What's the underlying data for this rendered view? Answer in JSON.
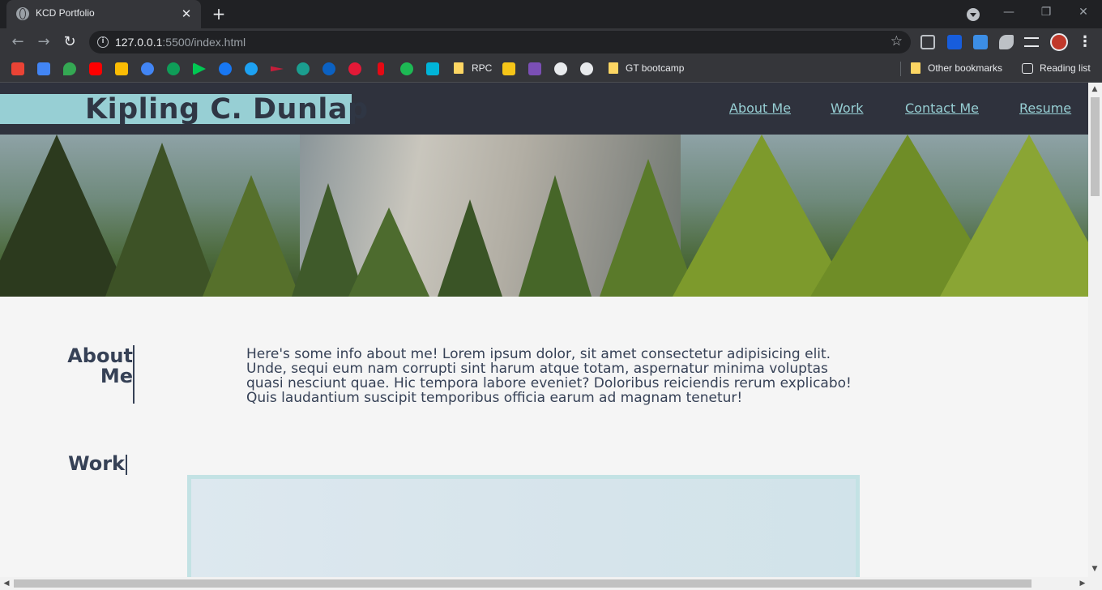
{
  "browser": {
    "tab_title": "KCD Portfolio",
    "url_host": "127.0.0.1",
    "url_path": ":5500/index.html",
    "bookmarks": [
      {
        "label": "RPC"
      },
      {
        "label": "GT bootcamp"
      },
      {
        "label": "Other bookmarks"
      },
      {
        "label": "Reading list"
      }
    ]
  },
  "site": {
    "name": "Kipling C. Dunlap",
    "nav": [
      {
        "label": "About Me"
      },
      {
        "label": "Work"
      },
      {
        "label": "Contact Me"
      },
      {
        "label": "Resume"
      }
    ],
    "about": {
      "title_line1": "About",
      "title_line2": "Me",
      "text": "Here's some info about me! Lorem ipsum dolor, sit amet consectetur adipisicing elit. Unde, sequi eum nam corrupti sint harum atque totam, aspernatur minima voluptas quasi nesciunt quae. Hic tempora labore eveniet? Doloribus reiciendis rerum explicabo! Quis laudantium suscipit temporibus officia earum ad magnam tenetur!"
    },
    "work": {
      "title": "Work"
    }
  },
  "colors": {
    "header_bg": "#2f323d",
    "accent": "#97cfd4",
    "text": "#364156"
  }
}
